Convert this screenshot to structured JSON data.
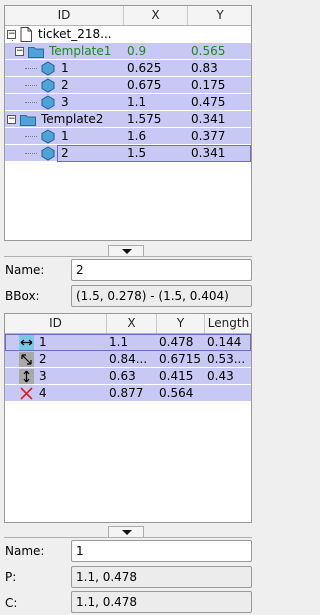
{
  "tree": {
    "columns": [
      "ID",
      "X",
      "Y"
    ],
    "root": {
      "label": "ticket_218..."
    },
    "rows": [
      {
        "id": "Template1",
        "x": "0.9",
        "y": "0.565",
        "color": "#1b8a1b"
      },
      {
        "id": "1",
        "x": "0.625",
        "y": "0.83"
      },
      {
        "id": "2",
        "x": "0.675",
        "y": "0.175"
      },
      {
        "id": "3",
        "x": "1.1",
        "y": "0.475"
      },
      {
        "id": "Template2",
        "x": "1.575",
        "y": "0.341"
      },
      {
        "id": "1",
        "x": "1.6",
        "y": "0.377"
      },
      {
        "id": "2",
        "x": "1.5",
        "y": "0.341"
      }
    ]
  },
  "details1": {
    "name_label": "Name:",
    "name_value": "2",
    "bbox_label": "BBox:",
    "bbox_value": "(1.5, 0.278) - (1.5, 0.404)"
  },
  "table": {
    "columns": [
      "ID",
      "X",
      "Y",
      "Length"
    ],
    "rows": [
      {
        "icon": "horizontal-arrow-icon",
        "id": "1",
        "x": "1.1",
        "y": "0.478",
        "length": "0.144"
      },
      {
        "icon": "diagonal-arrow-icon",
        "id": "2",
        "x": "0.84...",
        "y": "0.6715",
        "length": "0.53..."
      },
      {
        "icon": "vertical-arrow-icon",
        "id": "3",
        "x": "0.63",
        "y": "0.415",
        "length": "0.43"
      },
      {
        "icon": "red-x-icon",
        "id": "4",
        "x": "0.877",
        "y": "0.564",
        "length": ""
      }
    ]
  },
  "details2": {
    "name_label": "Name:",
    "name_value": "1",
    "p_label": "P:",
    "p_value": "1.1, 0.478",
    "c_label": "C:",
    "c_value": "1.1, 0.478"
  },
  "colors": {
    "selection": "#c8c8f4",
    "highlight_text": "#1b8a1b",
    "delete_icon": "#e02020",
    "arrow_icon_bg": "#a8a8a8",
    "first_arrow_bg": "#78c8e8"
  }
}
